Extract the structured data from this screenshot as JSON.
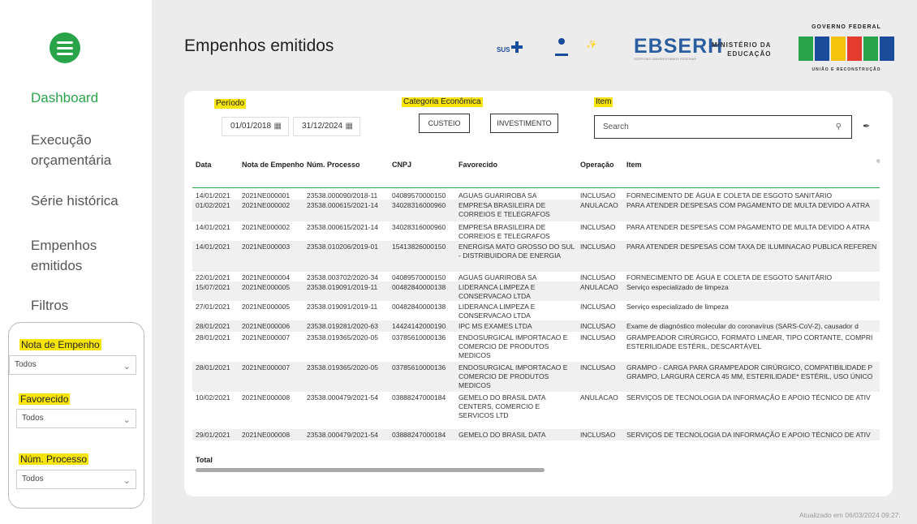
{
  "sidebar": {
    "nav": [
      {
        "label": "Dashboard"
      },
      {
        "label": "Execução orçamentária"
      },
      {
        "label": "Série histórica"
      },
      {
        "label": "Empenhos emitidos"
      },
      {
        "label": "Filtros"
      }
    ],
    "filters": [
      {
        "label": "Nota de Empenho",
        "value": "Todos"
      },
      {
        "label": "Favorecido",
        "value": "Todos"
      },
      {
        "label": "Núm. Processo",
        "value": "Todos"
      }
    ]
  },
  "header": {
    "title": "Empenhos emitidos",
    "logos": {
      "sus": "SUS",
      "ebserh": "EBSERH",
      "ebserh_sub": "HOSPITAIS UNIVERSITÁRIOS FEDERAIS",
      "mec_line1": "MINISTÉRIO DA",
      "mec_line2": "EDUCAÇÃO",
      "gov_top": "GOVERNO FEDERAL",
      "gov_bottom": "UNIÃO E RECONSTRUÇÃO"
    }
  },
  "filters_bar": {
    "periodo_label": "Período",
    "date_start": "01/01/2018",
    "date_end": "31/12/2024",
    "categoria_label": "Categoria Econômica",
    "categoria_options": [
      "CUSTEIO",
      "INVESTIMENTO"
    ],
    "item_label": "Item",
    "search_placeholder": "Search"
  },
  "table": {
    "headers": [
      "Data",
      "Nota de Empenho",
      "Núm. Processo",
      "CNPJ",
      "Favorecido",
      "Operação",
      "Item"
    ],
    "rows": [
      [
        "14/01/2021",
        "2021NE000001",
        "23538.000090/2018-11",
        "04089570000150",
        "AGUAS GUARIROBA SA",
        "INCLUSAO",
        "FORNECIMENTO DE ÁGUA E COLETA DE ESGOTO SANITÁRIO"
      ],
      [
        "01/02/2021",
        "2021NE000002",
        "23538.000615/2021-14",
        "34028316000960",
        "EMPRESA BRASILEIRA DE CORREIOS E TELEGRAFOS",
        "ANULACAO",
        "PARA ATENDER DESPESAS COM PAGAMENTO DE MULTA DEVIDO A ATRA"
      ],
      [
        "14/01/2021",
        "2021NE000002",
        "23538.000615/2021-14",
        "34028316000960",
        "EMPRESA BRASILEIRA DE CORREIOS E TELEGRAFOS",
        "INCLUSAO",
        "PARA ATENDER DESPESAS COM PAGAMENTO DE MULTA DEVIDO A ATRA"
      ],
      [
        "14/01/2021",
        "2021NE000003",
        "23538.010206/2019-01",
        "15413826000150",
        "ENERGISA MATO GROSSO DO SUL - DISTRIBUIDORA DE ENERGIA",
        "INCLUSAO",
        "PARA ATENDER DESPESAS COM TAXA DE ILUMINACAO PUBLICA REFEREN"
      ],
      [
        "22/01/2021",
        "2021NE000004",
        "23538.003702/2020-34",
        "04089570000150",
        "AGUAS GUARIROBA SA",
        "INCLUSAO",
        "FORNECIMENTO DE ÁGUA E COLETA DE ESGOTO SANITÁRIO"
      ],
      [
        "15/07/2021",
        "2021NE000005",
        "23538.019091/2019-11",
        "00482840000138",
        "LIDERANCA LIMPEZA E CONSERVACAO LTDA",
        "ANULACAO",
        "Serviço especializado de limpeza"
      ],
      [
        "27/01/2021",
        "2021NE000005",
        "23538.019091/2019-11",
        "00482840000138",
        "LIDERANCA LIMPEZA E CONSERVACAO LTDA",
        "INCLUSAO",
        "Serviço especializado de limpeza"
      ],
      [
        "28/01/2021",
        "2021NE000006",
        "23538.019281/2020-63",
        "14424142000190",
        "IPC MS EXAMES LTDA",
        "INCLUSAO",
        "Exame de diagnóstico molecular do coronavírus (SARS-CoV-2), causador d"
      ],
      [
        "28/01/2021",
        "2021NE000007",
        "23538.019365/2020-05",
        "03785610000136",
        "ENDOSURGICAL IMPORTACAO E COMERCIO DE PRODUTOS MEDICOS",
        "INCLUSAO",
        "GRAMPEADOR CIRÚRGICO, FORMATO LINEAR, TIPO CORTANTE, COMPRI ESTERILIDADE ESTÉRIL, DESCARTÁVEL"
      ],
      [
        "28/01/2021",
        "2021NE000007",
        "23538.019365/2020-05",
        "03785610000136",
        "ENDOSURGICAL IMPORTACAO E COMERCIO DE PRODUTOS MEDICOS",
        "INCLUSAO",
        "GRAMPO - CARGA PARA GRAMPEADOR CIRÚRGICO, COMPATIBILIDADE P GRAMPO, LARGURA CERCA 45 MM, ESTERILIDADE* ESTÉRIL, USO ÚNICO"
      ],
      [
        "10/02/2021",
        "2021NE000008",
        "23538.000479/2021-54",
        "03888247000184",
        "GEMELO DO BRASIL DATA CENTERS, COMERCIO E SERVICOS LTD",
        "ANULACAO",
        "SERVIÇOS DE TECNOLOGIA DA INFORMAÇÃO E APOIO TÉCNICO DE ATIV"
      ],
      [
        "29/01/2021",
        "2021NE000008",
        "23538.000479/2021-54",
        "03888247000184",
        "GEMELO DO BRASIL DATA",
        "INCLUSAO",
        "SERVIÇOS DE TECNOLOGIA DA INFORMAÇÃO E APOIO TÉCNICO DE ATIV"
      ]
    ],
    "total_label": "Total"
  },
  "footer": {
    "updated": "Atualizado em 06/03/2024 09:27:"
  },
  "colors": {
    "accent": "#2aa44a",
    "highlight": "#f6e40c",
    "background": "#ececec"
  }
}
